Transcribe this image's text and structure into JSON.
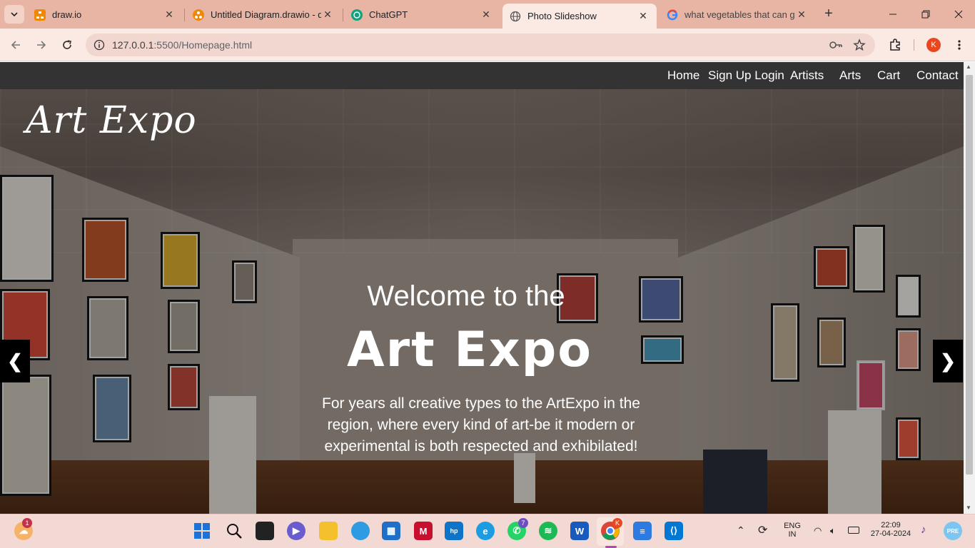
{
  "browser": {
    "tabs": [
      {
        "title": "draw.io",
        "favicon": "drawio-icon",
        "active": false
      },
      {
        "title": "Untitled Diagram.drawio - d",
        "favicon": "drawio-icon",
        "active": false
      },
      {
        "title": "ChatGPT",
        "favicon": "chatgpt-icon",
        "active": false
      },
      {
        "title": "Photo Slideshow",
        "favicon": "globe-icon",
        "active": true
      },
      {
        "title": "what vegetables that can gr",
        "favicon": "google-icon",
        "active": false
      }
    ],
    "url_host": "127.0.0.1",
    "url_path": ":5500/Homepage.html",
    "profile_initial": "K"
  },
  "site": {
    "nav": [
      "Home",
      "Sign Up Login",
      "Artists",
      "Arts",
      "Cart",
      "Contact"
    ],
    "logo": "Art Expo",
    "hero": {
      "welcome": "Welcome to the",
      "title": "Art Expo",
      "description": "For years all creative types to the ArtExpo in the region, where every kind of art-be it modern or experimental is both respected and exhibilated!",
      "prev": "❮",
      "next": "❯"
    }
  },
  "taskbar": {
    "weather_badge": "1",
    "whatsapp_badge": "7",
    "chrome_badge": "K",
    "lang": "ENG",
    "region": "IN",
    "time": "22:09",
    "date": "27-04-2024"
  }
}
